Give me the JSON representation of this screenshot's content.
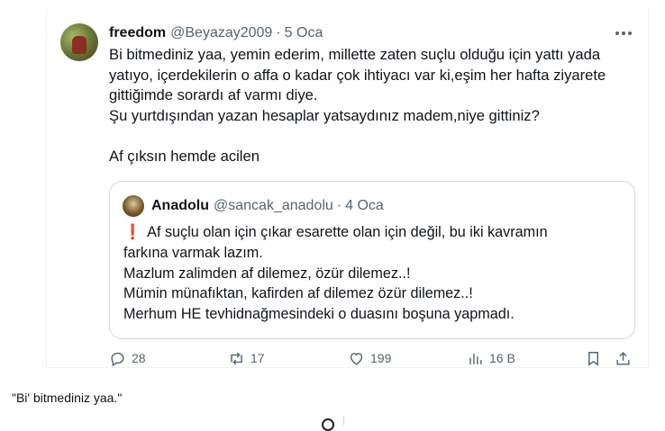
{
  "tweet": {
    "author": {
      "display_name": "freedom",
      "handle": "@Beyazay2009",
      "date": "5 Oca"
    },
    "separator": "·",
    "more_icon": "more-horizontal-icon",
    "text_lines": [
      "Bi bitmediniz yaa, yemin ederim, millette zaten suçlu olduğu için yattı yada",
      "yatıyo, içerdekilerin o affa o kadar çok ihtiyacı var ki,eşim her hafta ziyarete",
      "gittiğimde sorardı af varmı diye.",
      "Şu yurtdışından yazan hesaplar yatsaydınız madem,niye gittiniz?",
      "",
      "Af çıksın hemde acilen"
    ],
    "quoted": {
      "display_name": "Anadolu",
      "handle": "@sancak_anadolu",
      "date": "4 Oca",
      "exclamation": "❗",
      "text_lines": [
        "Af suçlu olan için çıkar esarette olan için değil, bu iki kavramın",
        "farkına varmak lazım.",
        "Mazlum zalimden af dilemez, özür dilemez..!",
        "Mümin münafıktan, kafirden af dilemez özür dilemez..!",
        "Merhum HE tevhidnağmesindeki o duasını boşuna yapmadı."
      ]
    },
    "actions": {
      "replies": "28",
      "retweets": "17",
      "likes": "199",
      "views": "16 B"
    }
  },
  "caption": "\"Bi' bitmediniz yaa.\"",
  "colors": {
    "text": "#0f1419",
    "secondary": "#536471",
    "border": "#cfd9de",
    "exclamation": "#e0245e"
  }
}
